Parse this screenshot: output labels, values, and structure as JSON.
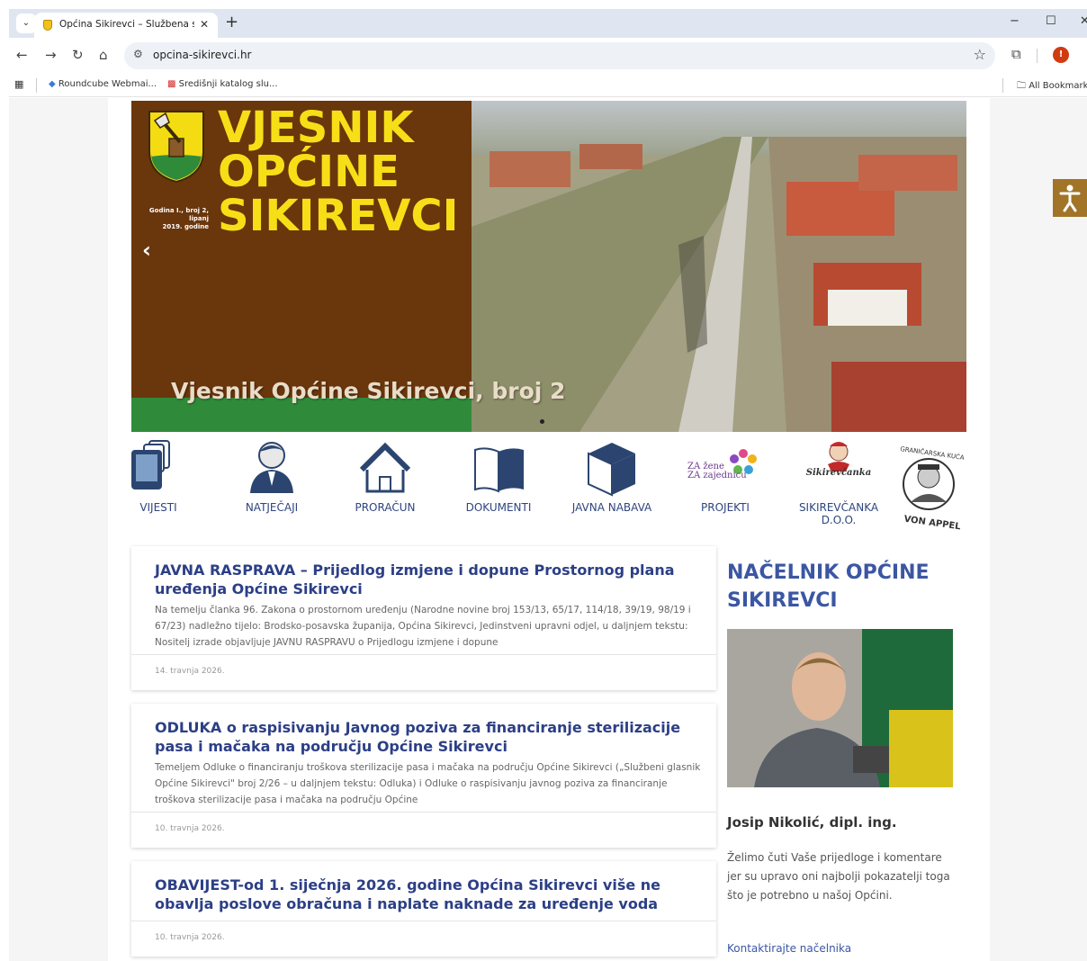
{
  "browser": {
    "tab_title": "Općina Sikirevci – Službena stra",
    "url": "opcina-sikirevci.hr",
    "bookmarks": [
      "Roundcube Webmai...",
      "Središnji katalog slu..."
    ],
    "all_bookmarks": "All Bookmarks"
  },
  "hero": {
    "masthead": [
      "VJESNIK",
      "OPĆINE",
      "SIKIREVCI"
    ],
    "edition": [
      "Godina I., broj 2,",
      "lipanj",
      "2019. godine"
    ],
    "caption": "Vjesnik Općine Sikirevci, broj 2"
  },
  "quicklinks": [
    {
      "label": "VIJESTI"
    },
    {
      "label": "NATJEČAJI"
    },
    {
      "label": "PRORAČUN"
    },
    {
      "label": "DOKUMENTI"
    },
    {
      "label": "JAVNA NABAVA"
    },
    {
      "label": "PROJEKTI",
      "logo_lines": [
        "ZA žene",
        "ZA zajednicu"
      ]
    },
    {
      "label": "SIKIREVČANKA D.O.O.",
      "logo_text": "Sikirevčanka"
    },
    {
      "label": "",
      "logo_top": "GRANIČARSKA KUĆA",
      "logo_bottom": "VON APPEL"
    }
  ],
  "news": [
    {
      "title": "JAVNA RASPRAVA – Prijedlog izmjene i dopune Prostornog plana uređenja Općine Sikirevci",
      "excerpt": "Na temelju članka 96. Zakona o prostornom uređenju (Narodne novine broj 153/13, 65/17, 114/18, 39/19, 98/19 i 67/23) nadležno tijelo: Brodsko-posavska županija, Općina Sikirevci, Jedinstveni upravni odjel, u daljnjem tekstu: Nositelj izrade objavljuje JAVNU RASPRAVU o Prijedlogu izmjene i dopune",
      "date": "14. travnja 2026."
    },
    {
      "title": "ODLUKA o raspisivanju Javnog poziva za financiranje sterilizacije pasa i mačaka na području Općine Sikirevci",
      "excerpt": "Temeljem Odluke o financiranju troškova sterilizacije pasa i mačaka na području Općine Sikirevci („Službeni glasnik Općine Sikirevci\" broj 2/26 – u daljnjem tekstu: Odluka) i Odluke o raspisivanju javnog poziva za financiranje troškova sterilizacije pasa i mačaka na području Općine",
      "date": "10. travnja 2026."
    },
    {
      "title": "OBAVIJEST-od 1. siječnja 2026. godine Općina Sikirevci više ne obavlja poslove obračuna i naplate naknade za uređenje voda",
      "excerpt": "",
      "date": "10. travnja 2026."
    }
  ],
  "sidebar": {
    "title": "NAČELNIK OPĆINE SIKIREVCI",
    "name": "Josip Nikolić, dipl. ing.",
    "text": "Želimo čuti Vaše prijedloge i komentare jer su upravo oni najbolji pokazatelji toga što je potrebno u našoj Općini.",
    "link": "Kontaktirajte načelnika"
  },
  "colors": {
    "brand_blue": "#2c3f86",
    "masthead_yellow": "#f6df17",
    "masthead_brown": "#6a360c",
    "accessibility_gold": "#a17427"
  }
}
